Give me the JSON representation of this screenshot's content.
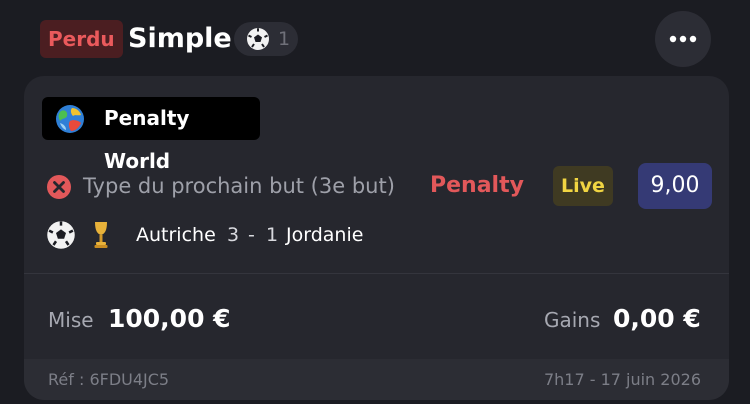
{
  "header": {
    "status": "Perdu",
    "bet_type": "Simple",
    "sport_icon": "soccer-ball-icon",
    "selections_count": "1",
    "more_icon": "more-horizontal-icon"
  },
  "card": {
    "competition": {
      "icon": "globe-icon",
      "name": "Penalty World"
    },
    "selection": {
      "result_icon": "lost-x-icon",
      "market": "Type du prochain but (3e but)",
      "pick": "Penalty",
      "live_label": "Live",
      "odds": "9,00"
    },
    "match": {
      "sport_icon": "soccer-ball-icon",
      "competition_icon": "trophy-icon",
      "home_team": "Autriche",
      "home_score": "3",
      "separator": "-",
      "away_score": "1",
      "away_team": "Jordanie"
    },
    "stake": {
      "label": "Mise",
      "value": "100,00 €"
    },
    "gains": {
      "label": "Gains",
      "value": "0,00 €"
    },
    "footer": {
      "reference": "Réf : 6FDU4JC5",
      "date": "7h17 - 17 juin 2026"
    }
  },
  "colors": {
    "background": "#1b1c22",
    "card": "#26272e",
    "lost_red": "#e2585a",
    "live_yellow": "#f1d542",
    "odds_blue": "#353a75"
  }
}
